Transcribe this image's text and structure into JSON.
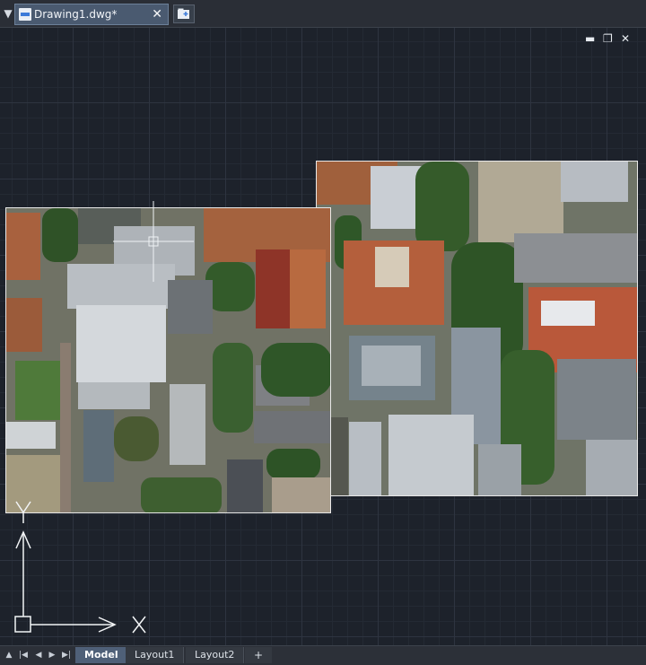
{
  "document_tab": {
    "icon": "dwg-file-icon",
    "title": "Drawing1.dwg*"
  },
  "canvas": {
    "window_controls": [
      "minimize-icon",
      "restore-icon",
      "close-icon"
    ]
  },
  "ucs": {
    "x_label": "X",
    "y_label": "Y"
  },
  "layout_tabs": {
    "tabs": [
      {
        "label": "Model",
        "active": true
      },
      {
        "label": "Layout1",
        "active": false
      },
      {
        "label": "Layout2",
        "active": false
      }
    ],
    "add_label": "+"
  },
  "colors": {
    "tab_active": "#4f6078",
    "canvas": "#1d222b",
    "roof_terracotta": "#b45f3c"
  }
}
